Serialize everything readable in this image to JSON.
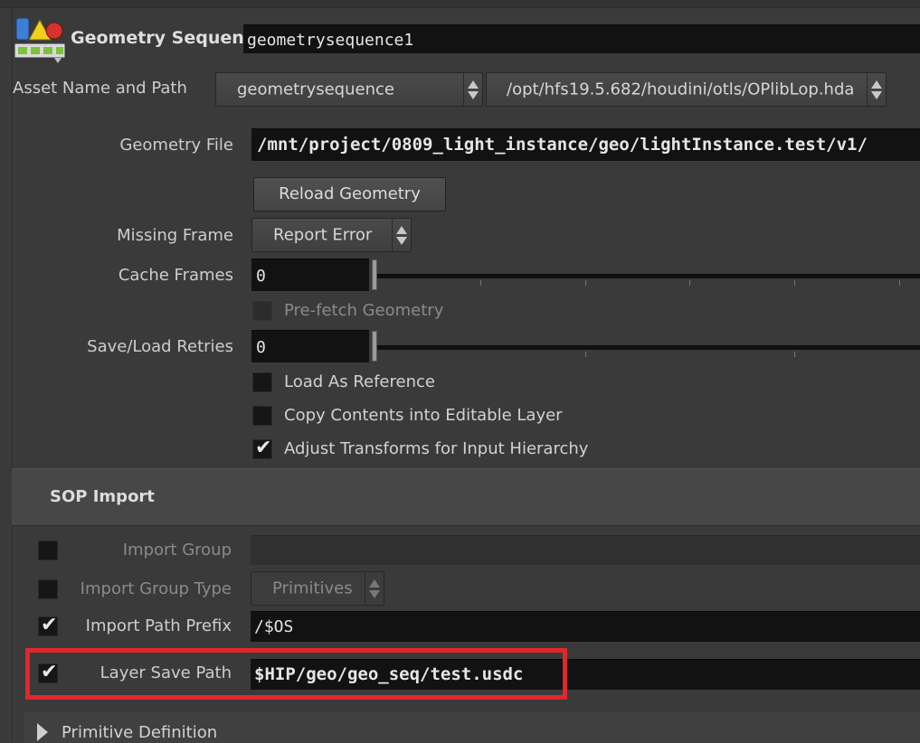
{
  "header": {
    "node_type": "Geometry Sequence",
    "node_name": "geometrysequence1"
  },
  "asset": {
    "label": "Asset Name and Path",
    "name": "geometrysequence",
    "path": "/opt/hfs19.5.682/houdini/otls/OPlibLop.hda"
  },
  "params": {
    "geometry_file_label": "Geometry File",
    "geometry_file_value": "/mnt/project/0809_light_instance/geo/lightInstance.test/v1/",
    "reload_button": "Reload Geometry",
    "missing_frame_label": "Missing Frame",
    "missing_frame_value": "Report Error",
    "cache_frames_label": "Cache Frames",
    "cache_frames_value": "0",
    "prefetch_label": "Pre-fetch Geometry",
    "retries_label": "Save/Load Retries",
    "retries_value": "0",
    "load_as_reference": "Load As Reference",
    "copy_contents": "Copy Contents into Editable Layer",
    "adjust_transforms": "Adjust Transforms for Input Hierarchy"
  },
  "sop_import": {
    "title": "SOP Import",
    "import_group_label": "Import Group",
    "import_group_value": "",
    "import_group_type_label": "Import Group Type",
    "import_group_type_value": "Primitives",
    "import_path_prefix_label": "Import Path Prefix",
    "import_path_prefix_value": "/$OS",
    "layer_save_path_label": "Layer Save Path",
    "layer_save_path_value": "$HIP/geo/geo_seq/test.usdc"
  },
  "primitive_definition": {
    "title": "Primitive Definition"
  },
  "colors": {
    "highlight": "#e0282b",
    "background": "#3a3a3a",
    "field": "#121212"
  }
}
